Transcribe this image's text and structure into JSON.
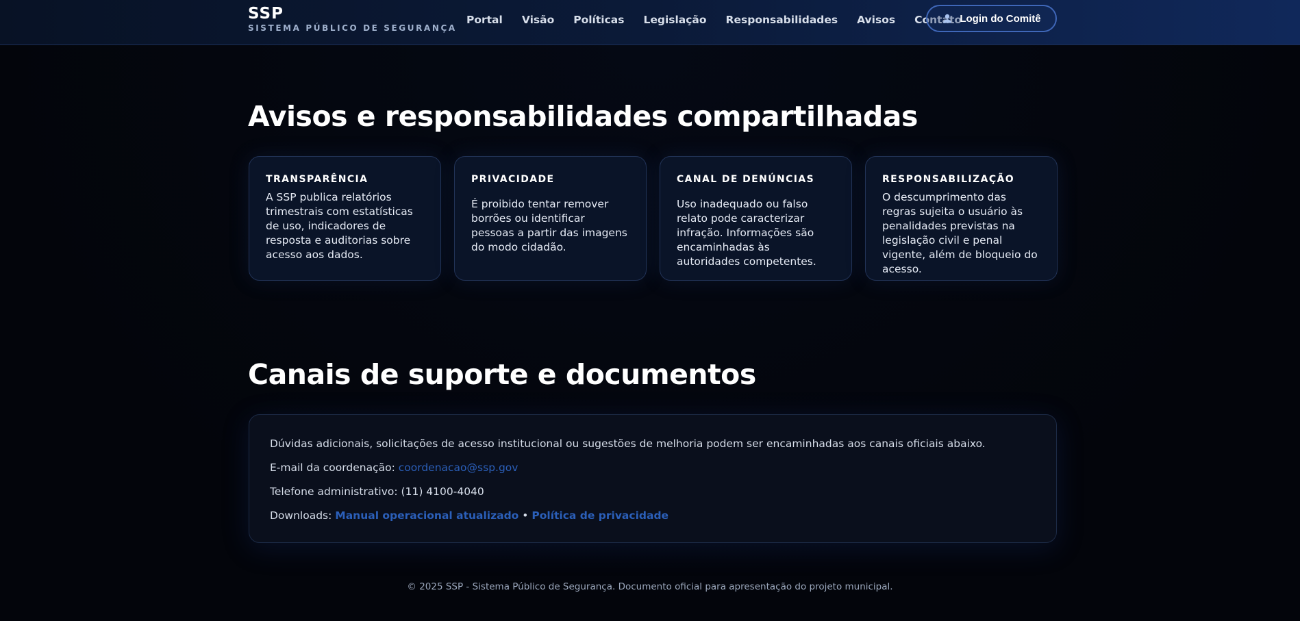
{
  "header": {
    "brand_name": "SSP",
    "brand_subtitle": "SISTEMA PÚBLICO DE SEGURANÇA",
    "nav": [
      "Portal",
      "Visão",
      "Políticas",
      "Legislação",
      "Responsabilidades",
      "Avisos",
      "Contato"
    ],
    "login_label": "Login do Comitê",
    "login_icon": "user-icon"
  },
  "notices": {
    "title": "Avisos e responsabilidades compartilhadas",
    "cards": [
      {
        "title": "TRANSPARÊNCIA",
        "text": "A SSP publica relatórios trimestrais com estatísticas de uso, indicadores de resposta e auditorias sobre acesso aos dados."
      },
      {
        "title": "PRIVACIDADE",
        "text": "É proibido tentar remover borrões ou identificar pessoas a partir das imagens do modo cidadão."
      },
      {
        "title": "CANAL DE DENÚNCIAS",
        "text": "Uso inadequado ou falso relato pode caracterizar infração. Informações são encaminhadas às autoridades competentes."
      },
      {
        "title": "RESPONSABILIZAÇÃO",
        "text": "O descumprimento das regras sujeita o usuário às penalidades previstas na legislação civil e penal vigente, além de bloqueio do acesso."
      }
    ]
  },
  "support": {
    "title": "Canais de suporte e documentos",
    "intro": "Dúvidas adicionais, solicitações de acesso institucional ou sugestões de melhoria podem ser encaminhadas aos canais oficiais abaixo.",
    "email_label": "E-mail da coordenação:",
    "email": "coordenacao@ssp.gov",
    "phone_label": "Telefone administrativo:",
    "phone": "(11) 4100-4040",
    "downloads_label": "Downloads:",
    "download_links": [
      "Manual operacional atualizado",
      "Política de privacidade"
    ],
    "separator": "•"
  },
  "footer": {
    "text": "© 2025 SSP - Sistema Público de Segurança. Documento oficial para apresentação do projeto municipal."
  },
  "colors": {
    "accent": "#2b5fb9",
    "background": "#04060c",
    "card_background": "#0a1428"
  }
}
